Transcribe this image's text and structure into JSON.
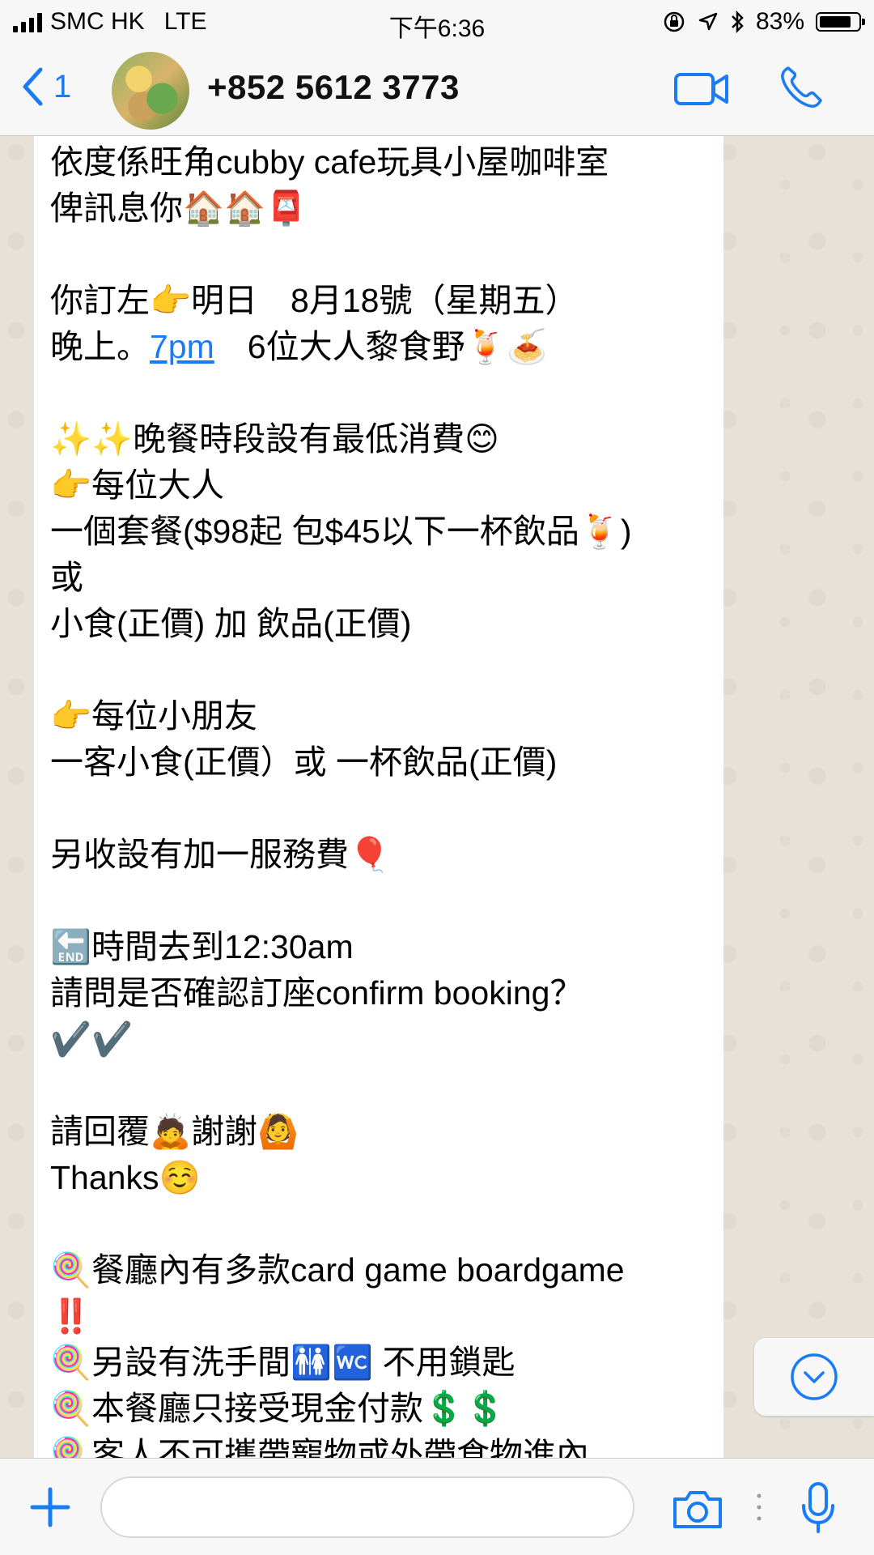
{
  "status_bar": {
    "carrier": "SMC HK",
    "network": "LTE",
    "time": "下午6:36",
    "battery_text": "83%",
    "battery_level": 0.83
  },
  "header": {
    "back_count": "1",
    "contact_name": "+852 5612 3773",
    "icons": [
      "chevron-left-icon",
      "video-camera-icon",
      "phone-icon"
    ]
  },
  "message": {
    "lines": [
      "依度係旺角cubby cafe玩具小屋咖啡室",
      "俾訊息你🏠🏠📮",
      "",
      "你訂左👉明日　8月18號（星期五）",
      "晚上。",
      "",
      "✨✨晚餐時段設有最低消費😊",
      "👉每位大人",
      "一個套餐($98起 包$45以下一杯飲品🍹)",
      "或",
      "小食(正價) 加 飲品(正價)",
      "",
      "👉每位小朋友",
      "一客小食(正價）或 一杯飲品(正價)",
      "",
      "另收設有加一服務費🎈",
      "",
      "🔚時間去到12:30am",
      "請問是否確認訂座confirm booking？",
      "✔️✔️",
      "",
      "請回覆🙇謝謝🙆",
      "Thanks☺️",
      "",
      "🍭餐廳內有多款card game boardgame",
      "‼️",
      "🍭另設有洗手間🚻🚾 不用鎖匙",
      "🍭本餐廳只接受現金付款💲💲",
      "🍭客人不可攜帶寵物或外帶食物進內"
    ],
    "line5_link": "7pm",
    "line5_rest": "　6位大人黎食野🍹🍝"
  },
  "input": {
    "placeholder": "",
    "icons": [
      "plus-icon",
      "camera-icon",
      "microphone-icon"
    ]
  },
  "scroll_button": {
    "icon": "chevron-down-circle-icon"
  },
  "colors": {
    "accent": "#1a7cf5",
    "bubble": "#ffffff",
    "wallpaper": "#e8e1d8",
    "bar": "#f7f7f7"
  }
}
